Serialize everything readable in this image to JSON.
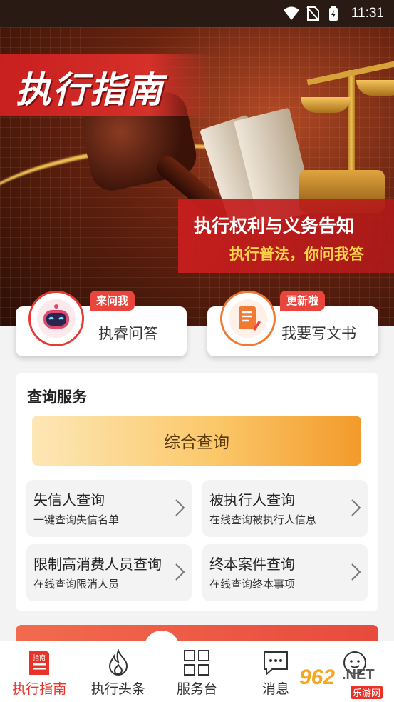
{
  "status_bar": {
    "time": "11:31"
  },
  "banner": {
    "title": "执行指南",
    "notice_title": "执行权利与义务告知",
    "notice_subtitle": "执行普法，你问我答"
  },
  "quick_actions": [
    {
      "label": "执睿问答",
      "badge": "来问我"
    },
    {
      "label": "我要写文书",
      "badge": "更新啦"
    }
  ],
  "query_panel": {
    "title": "查询服务",
    "main_button": "综合查询",
    "services": [
      {
        "title": "失信人查询",
        "subtitle": "一键查询失信名单"
      },
      {
        "title": "被执行人查询",
        "subtitle": "在线查询被执行人信息"
      },
      {
        "title": "限制高消费人员查询",
        "subtitle": "在线查询限消人员"
      },
      {
        "title": "终本案件查询",
        "subtitle": "在线查询终本事项"
      }
    ]
  },
  "bottom_nav": [
    {
      "label": "执行指南",
      "icon": "guide-book-icon",
      "active": true,
      "badge_text": "指南"
    },
    {
      "label": "执行头条",
      "icon": "flame-icon",
      "active": false
    },
    {
      "label": "服务台",
      "icon": "grid-icon",
      "active": false
    },
    {
      "label": "消息",
      "icon": "chat-bubble-icon",
      "active": false
    },
    {
      "label": "",
      "icon": "profile-icon",
      "active": false
    }
  ],
  "watermark": {
    "text": "962",
    "net": ".NET",
    "sub": "乐游网"
  },
  "colors": {
    "accent": "#e8332a",
    "gold": "#f39a2b"
  }
}
